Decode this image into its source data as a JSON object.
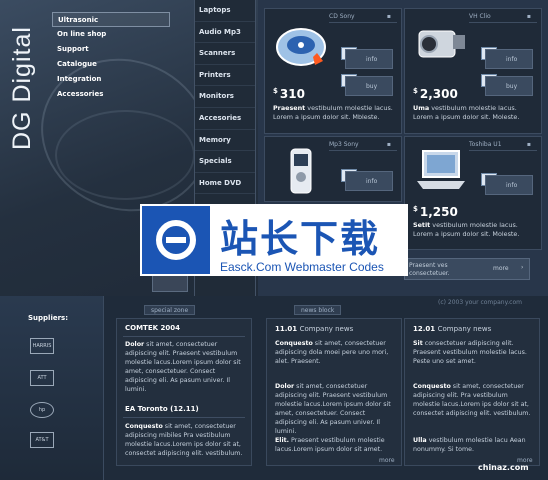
{
  "brand": "DG Digital",
  "nav_left": [
    "Ultrasonic",
    "On line shop",
    "Support",
    "Catalogue",
    "Integration",
    "Accessories"
  ],
  "categories": [
    "Laptops",
    "Audio Mp3",
    "Scanners",
    "Printers",
    "Monitors",
    "Accesories",
    "Memory",
    "Specials",
    "Home DVD"
  ],
  "products": [
    {
      "brand": "CD Sony",
      "price": "310",
      "currency": "$",
      "info": "info",
      "buy": "buy",
      "bold": "Praesent",
      "desc": "vestibulum molestie lacus. Lorem a ipsum dolor sit. Mbleste."
    },
    {
      "brand": "VH Clio",
      "price": "2,300",
      "currency": "$",
      "info": "info",
      "buy": "buy",
      "bold": "Uma",
      "desc": "vestibulum molestie lacus. Lorem a ipsum dolor sit. Moleste."
    },
    {
      "brand": "Mp3 Sony",
      "price": "",
      "currency": "",
      "info": "info",
      "buy": "buy",
      "bold": "",
      "desc": ""
    },
    {
      "brand": "Toshiba U1",
      "price": "1,250",
      "currency": "$",
      "info": "info",
      "buy": "buy",
      "bold": "Setit",
      "desc": "vestibulum molestie lacus. Lorem a ipsum dolor sit. Moleste."
    }
  ],
  "footer_strip": {
    "text1": "Praesent ves",
    "text2": "consectetuer.",
    "more": "more"
  },
  "watermark": {
    "cn": "站长下载",
    "en": "Easck.Com Webmaster Codes"
  },
  "copyright": "(c) 2003 your company.com",
  "suppliers": {
    "title": "Suppliers:",
    "logos": [
      "HARRIS",
      "ATT",
      "hp",
      "AT&T"
    ]
  },
  "special": {
    "tab": "special zone",
    "item1": {
      "title": "COMTEK 2004",
      "bold": "Dolor",
      "text": "sit amet, consectetuer adipiscing elit. Praesent vestibulum molestie lacus.Lorem ipsum dolor sit amet, consectetuer. Consect adipiscing eli. As pasum univer. Il lumini."
    },
    "item2": {
      "title": "EA Toronto (12.11)",
      "bold": "Conquesto",
      "text": "sit amet, consectetuer adipiscing mibiles Pra vestibulum molestie lacus.Lorem ips dolor sit at, consectet adipiscing elit. vestibulum."
    }
  },
  "news": {
    "tab": "news block",
    "col1": {
      "date": "11.01",
      "sub": "Company news",
      "p1b": "Conquesto",
      "p1": "sit amet, consectetuer adipiscing dola moei pere uno mori, alet. Praesent.",
      "p2b": "Dolor",
      "p2": "sit amet, consectetuer adipiscing elit. Praesent vestibulum molestie lacus.Lorem ipsum dolor sit amet, consectetuer. Consect adipiscing eli. As pasum univer. Il lumini.",
      "p3b": "Elit.",
      "p3": "Praesent vestibulum molestie lacus.Lorem ipsum dolor sit amet.",
      "more": "more"
    },
    "col2": {
      "date": "12.01",
      "sub": "Company news",
      "p1b": "Sit",
      "p1": "consectetuer adipiscing elit. Praesent vestibulum molestie lacus. Peste uno set amet.",
      "p2b": "Conquesto",
      "p2": "sit amet, consectetuer adipiscing elit. Pra vestibulum molestie lacus.Lorem ips dolor sit at, consectet adipiscing elit. vestibulum.",
      "p3b": "Ulla",
      "p3": "vestibulum molestie lacu Aean nonummy. Si tome.",
      "more": "more"
    }
  },
  "chinaz": "chinaz.com"
}
